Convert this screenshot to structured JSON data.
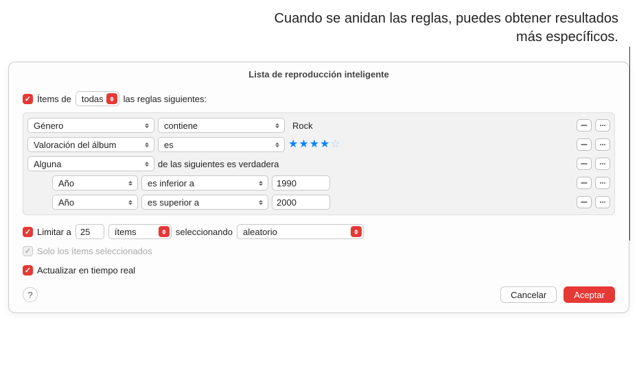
{
  "annotation": "Cuando se anidan las reglas, puedes obtener resultados más específicos.",
  "title": "Lista de reproducción inteligente",
  "match": {
    "prefix": "Ítems de",
    "selector": "todas",
    "suffix": "las reglas siguientes:"
  },
  "rules": [
    {
      "attr": "Género",
      "op": "contiene",
      "value": "Rock",
      "value_type": "text"
    },
    {
      "attr": "Valoración del álbum",
      "op": "es",
      "value_type": "stars",
      "stars": 4,
      "stars_max": 5
    },
    {
      "attr": "Alguna",
      "tail": "de las siguientes es verdadera",
      "value_type": "group"
    }
  ],
  "nested_rules": [
    {
      "attr": "Año",
      "op": "es inferior a",
      "value": "1990"
    },
    {
      "attr": "Año",
      "op": "es superior a",
      "value": "2000"
    }
  ],
  "limit": {
    "label": "Limitar a",
    "count": "25",
    "unit": "ítems",
    "select_label": "seleccionando",
    "method": "aleatorio"
  },
  "only_selected": "Solo los ítems seleccionados",
  "live_update": "Actualizar en tiempo real",
  "buttons": {
    "cancel": "Cancelar",
    "ok": "Aceptar",
    "help": "?"
  },
  "icons": {
    "minus": "minus",
    "more": "more"
  }
}
